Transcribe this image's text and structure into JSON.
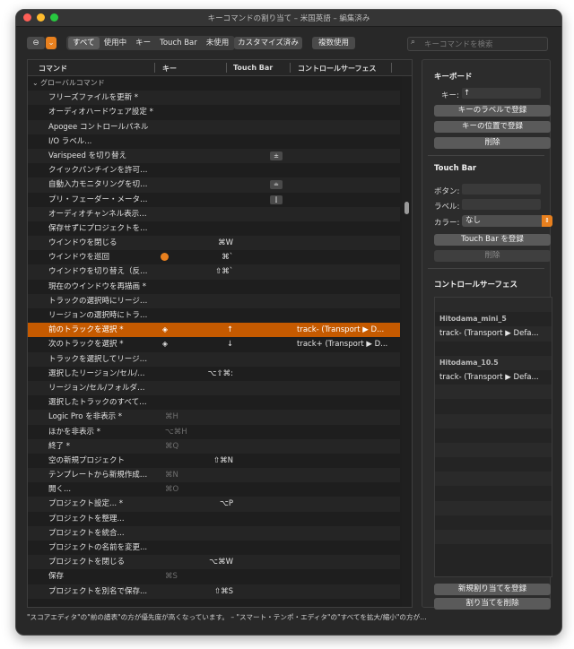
{
  "window": {
    "title": "キーコマンドの割り当て – 米国英語 – 編集済み"
  },
  "toolbar": {
    "filters": [
      "すべて",
      "使用中",
      "キー",
      "Touch Bar",
      "未使用"
    ],
    "customized_label": "カスタマイズ済み",
    "multiple_label": "複数使用",
    "search_placeholder": "キーコマンドを検索"
  },
  "table": {
    "headers": {
      "command": "コマンド",
      "key": "キー",
      "touchbar": "Touch Bar",
      "control_surface": "コントロールサーフェス"
    },
    "group": "グローバルコマンド",
    "rows": [
      {
        "cmd": "フリーズファイルを更新 *"
      },
      {
        "cmd": "オーディオハードウェア設定 *"
      },
      {
        "cmd": "Apogee コントロールパネル"
      },
      {
        "cmd": "I/O ラベル..."
      },
      {
        "cmd": "Varispeed を切り替え",
        "tb": "±"
      },
      {
        "cmd": "クイックパンチインを許可…"
      },
      {
        "cmd": "自動入力モニタリングを切…",
        "tb": "≐"
      },
      {
        "cmd": "プリ・フェーダー・メータ…",
        "tb": "⫿"
      },
      {
        "cmd": "オーディオチャンネル表示…"
      },
      {
        "cmd": "保存せずにプロジェクトを…"
      },
      {
        "cmd": "ウインドウを閉じる",
        "key": "⌘W"
      },
      {
        "cmd": "ウインドウを巡回",
        "key": "⌘`",
        "dot": true
      },
      {
        "cmd": "ウインドウを切り替え（反…",
        "key": "⇧⌘`"
      },
      {
        "cmd": "現在のウインドウを再描画 *"
      },
      {
        "cmd": "トラックの選択時にリージ…"
      },
      {
        "cmd": "リージョンの選択時にトラ…"
      },
      {
        "cmd": "前のトラックを選択 *",
        "key": "↑",
        "layer": true,
        "cs": "track- (Transport ▶ D...",
        "selected": true
      },
      {
        "cmd": "次のトラックを選択 *",
        "key": "↓",
        "layer": true,
        "cs": "track+ (Transport ▶ D..."
      },
      {
        "cmd": "トラックを選択してリージ…"
      },
      {
        "cmd": "選択したリージョン/セル/…",
        "key": "⌥⇧⌘:"
      },
      {
        "cmd": "リージョン/セル/フォルダ…"
      },
      {
        "cmd": "選択したトラックのすべて…"
      },
      {
        "cmd": "Logic Pro を非表示 *",
        "dimkey": "⌘H"
      },
      {
        "cmd": "ほかを非表示 *",
        "dimkey": "⌥⌘H"
      },
      {
        "cmd": "終了 *",
        "dimkey": "⌘Q"
      },
      {
        "cmd": "空の新規プロジェクト",
        "key": "⇧⌘N"
      },
      {
        "cmd": "テンプレートから新規作成…",
        "dimkey": "⌘N"
      },
      {
        "cmd": "開く...",
        "dimkey": "⌘O"
      },
      {
        "cmd": "プロジェクト設定... *",
        "key": "⌥P"
      },
      {
        "cmd": "プロジェクトを整理..."
      },
      {
        "cmd": "プロジェクトを統合..."
      },
      {
        "cmd": "プロジェクトの名前を変更..."
      },
      {
        "cmd": "プロジェクトを閉じる",
        "key": "⌥⌘W"
      },
      {
        "cmd": "保存",
        "dimkey": "⌘S"
      },
      {
        "cmd": "プロジェクトを別名で保存...",
        "key": "⇧⌘S"
      }
    ]
  },
  "sidebar": {
    "keyboard_title": "キーボード",
    "key_label": "キー:",
    "key_value": "↑",
    "learn_by_label": "キーのラベルで登録",
    "learn_by_position": "キーの位置で登録",
    "delete": "削除",
    "touchbar_title": "Touch Bar",
    "button_label": "ボタン:",
    "label_label": "ラベル:",
    "color_label": "カラー:",
    "color_value": "なし",
    "register_touchbar": "Touch Bar を登録",
    "delete2": "削除",
    "cs_title": "コントロールサーフェス",
    "cs_items": [
      {
        "device": "Hitodama_mini_5",
        "assign": "track- (Transport ▶ Defa..."
      },
      {
        "device": "Hitodama_10.5",
        "assign": "track- (Transport ▶ Defa..."
      }
    ],
    "new_assignment": "新規割り当てを登録",
    "delete_assignment": "割り当てを削除"
  },
  "status": "\"スコアエディタ\"の\"前の譜表\"の方が優先度が高くなっています。 – \"スマート・テンポ・エディタ\"の\"すべてを拡大/縮小\"の方が…"
}
